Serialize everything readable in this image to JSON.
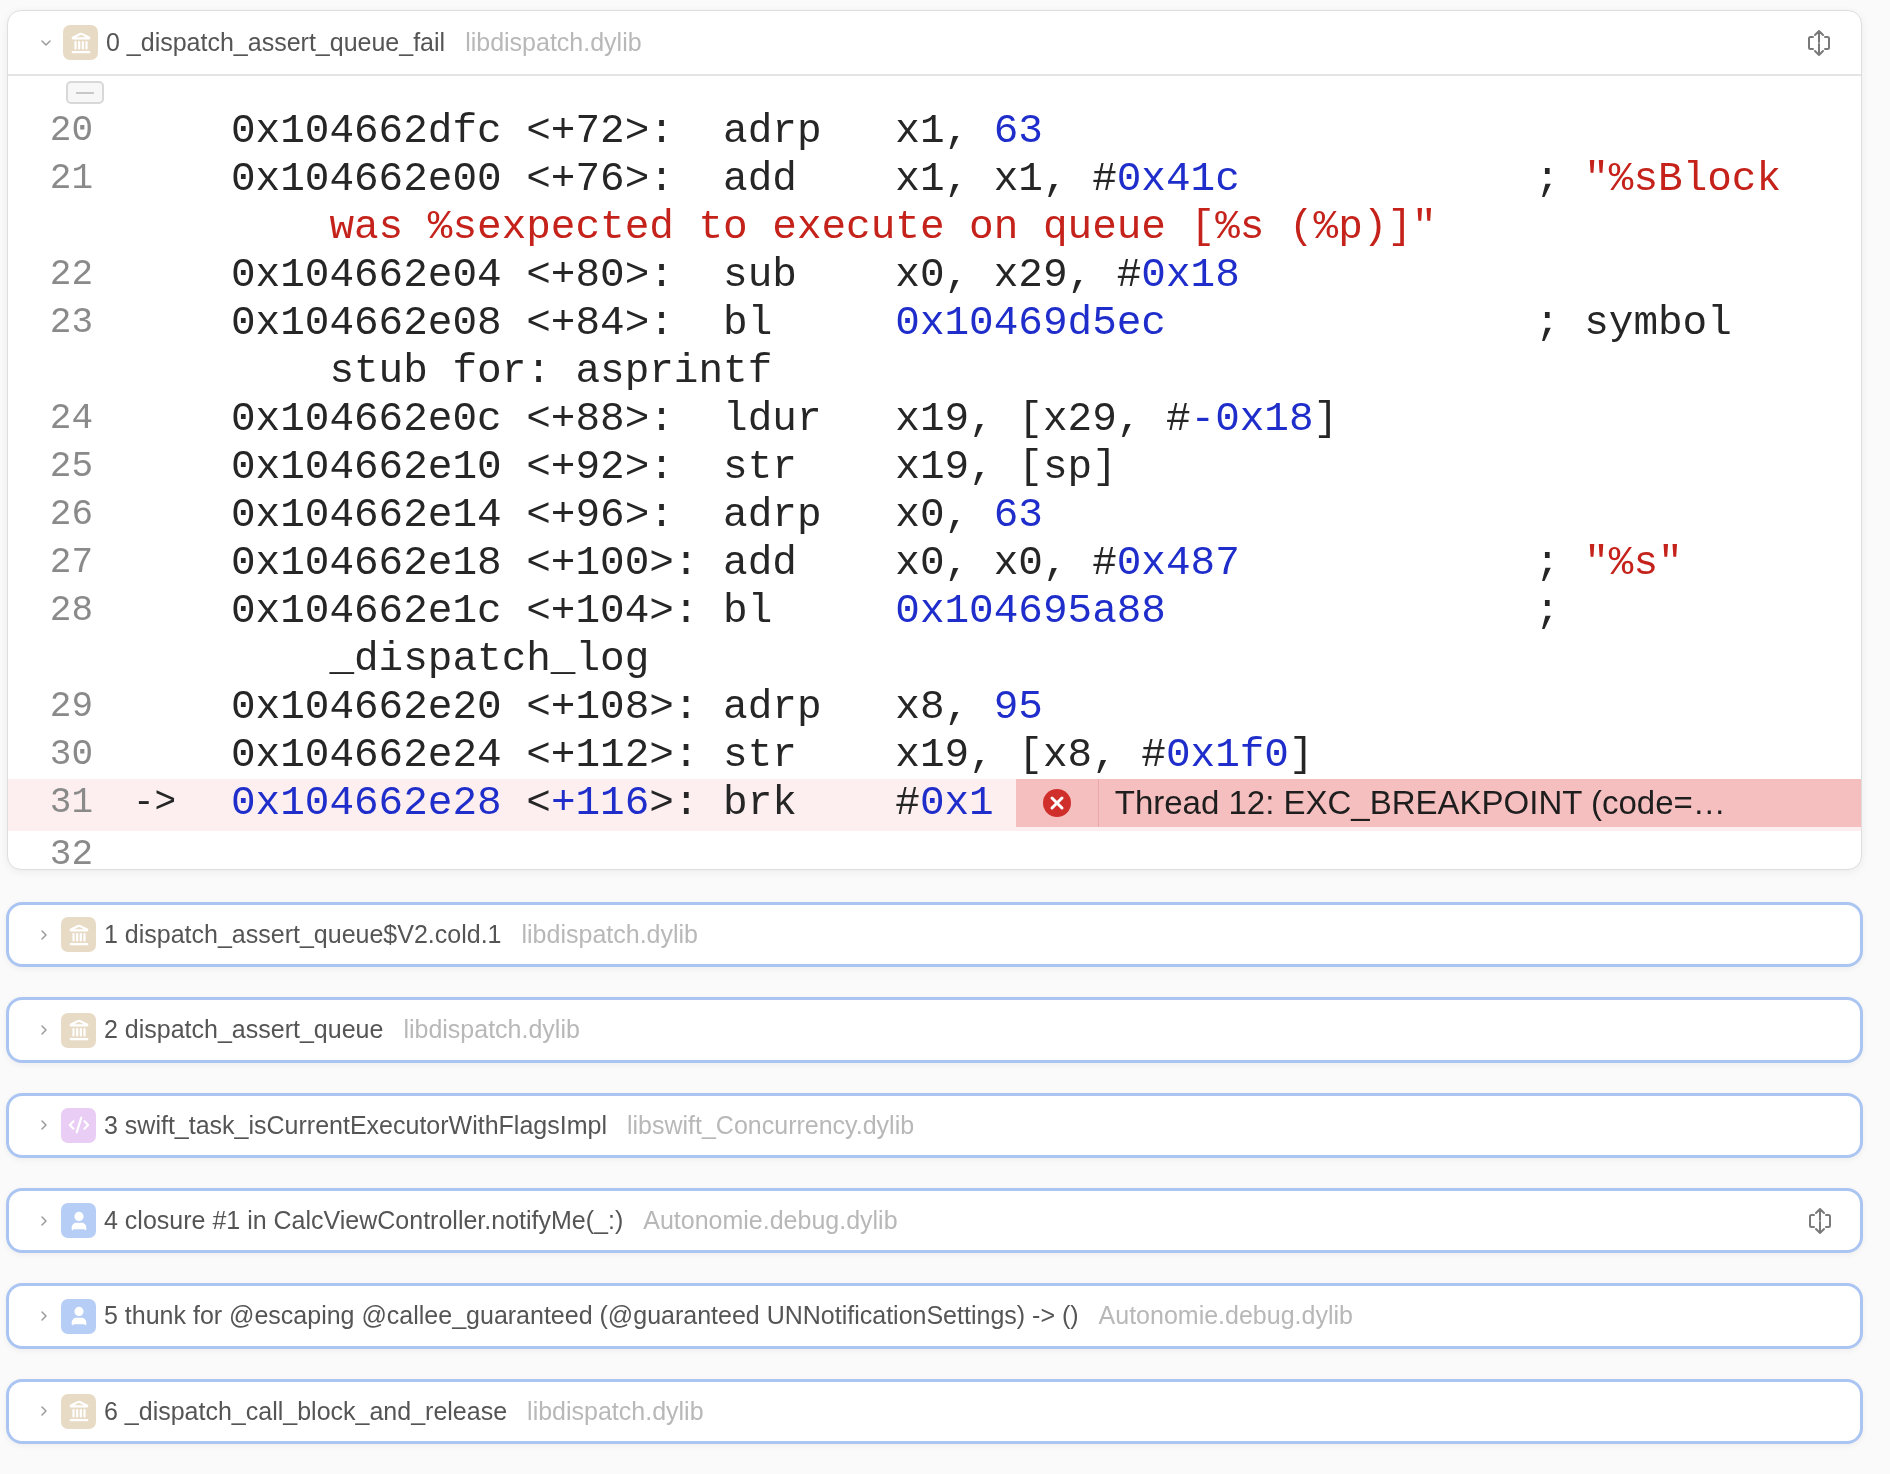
{
  "frames": [
    {
      "label": "0 _dispatch_assert_queue_fail",
      "library": "libdispatch.dylib",
      "kind": "library",
      "expanded": true,
      "focus_button": true,
      "disassembly": [
        {
          "number": "20",
          "address": [
            {
              "text": "0x104662dfc <+72>:",
              "kind": "plain"
            }
          ],
          "mnemonic": "adrp",
          "operands": [
            {
              "text": "x1, ",
              "kind": "plain"
            },
            {
              "text": "63",
              "kind": "num"
            }
          ]
        },
        {
          "number": "21",
          "address": [
            {
              "text": "0x104662e00 <+76>:",
              "kind": "plain"
            }
          ],
          "mnemonic": "add",
          "operands": [
            {
              "text": "x1, x1, #",
              "kind": "plain"
            },
            {
              "text": "0x41c",
              "kind": "num"
            }
          ],
          "comment": [
            {
              "text": "; ",
              "kind": "plain"
            },
            {
              "text": "\"%sBlock was %sexpected to execute on queue [%s (%p)]\"",
              "kind": "str"
            }
          ]
        },
        {
          "number": "22",
          "address": [
            {
              "text": "0x104662e04 <+80>:",
              "kind": "plain"
            }
          ],
          "mnemonic": "sub",
          "operands": [
            {
              "text": "x0, x29, #",
              "kind": "plain"
            },
            {
              "text": "0x18",
              "kind": "num"
            }
          ]
        },
        {
          "number": "23",
          "address": [
            {
              "text": "0x104662e08 <+84>:",
              "kind": "plain"
            }
          ],
          "mnemonic": "bl",
          "operands": [
            {
              "text": "0x10469d5ec",
              "kind": "num"
            }
          ],
          "comment": [
            {
              "text": "; symbol stub for: asprintf",
              "kind": "plain"
            }
          ]
        },
        {
          "number": "24",
          "address": [
            {
              "text": "0x104662e0c <+88>:",
              "kind": "plain"
            }
          ],
          "mnemonic": "ldur",
          "operands": [
            {
              "text": "x19, [x29, #",
              "kind": "plain"
            },
            {
              "text": "-0x18",
              "kind": "num"
            },
            {
              "text": "]",
              "kind": "plain"
            }
          ]
        },
        {
          "number": "25",
          "address": [
            {
              "text": "0x104662e10 <+92>:",
              "kind": "plain"
            }
          ],
          "mnemonic": "str",
          "operands": [
            {
              "text": "x19, [sp]",
              "kind": "plain"
            }
          ]
        },
        {
          "number": "26",
          "address": [
            {
              "text": "0x104662e14 <+96>:",
              "kind": "plain"
            }
          ],
          "mnemonic": "adrp",
          "operands": [
            {
              "text": "x0, ",
              "kind": "plain"
            },
            {
              "text": "63",
              "kind": "num"
            }
          ]
        },
        {
          "number": "27",
          "address": [
            {
              "text": "0x104662e18 <+100>:",
              "kind": "plain"
            }
          ],
          "mnemonic": "add",
          "operands": [
            {
              "text": "x0, x0, #",
              "kind": "plain"
            },
            {
              "text": "0x487",
              "kind": "num"
            }
          ],
          "comment": [
            {
              "text": "; ",
              "kind": "plain"
            },
            {
              "text": "\"%s\"",
              "kind": "str"
            }
          ]
        },
        {
          "number": "28",
          "address": [
            {
              "text": "0x104662e1c <+104>:",
              "kind": "plain"
            }
          ],
          "mnemonic": "bl",
          "operands": [
            {
              "text": "0x104695a88",
              "kind": "num"
            }
          ],
          "comment": [
            {
              "text": "; _dispatch_log",
              "kind": "plain"
            }
          ]
        },
        {
          "number": "29",
          "address": [
            {
              "text": "0x104662e20 <+108>:",
              "kind": "plain"
            }
          ],
          "mnemonic": "adrp",
          "operands": [
            {
              "text": "x8, ",
              "kind": "plain"
            },
            {
              "text": "95",
              "kind": "num"
            }
          ]
        },
        {
          "number": "30",
          "address": [
            {
              "text": "0x104662e24 <+112>:",
              "kind": "plain"
            }
          ],
          "mnemonic": "str",
          "operands": [
            {
              "text": "x19, [x8, #",
              "kind": "plain"
            },
            {
              "text": "0x1f0",
              "kind": "num"
            },
            {
              "text": "]",
              "kind": "plain"
            }
          ]
        },
        {
          "number": "31",
          "current": true,
          "marker": "->",
          "address": [
            {
              "text": "0x104662e28",
              "kind": "num"
            },
            {
              "text": " <",
              "kind": "plain"
            },
            {
              "text": "+116",
              "kind": "num"
            },
            {
              "text": ">:",
              "kind": "plain"
            }
          ],
          "mnemonic": "brk",
          "operands": [
            {
              "text": "#",
              "kind": "plain"
            },
            {
              "text": "0x1",
              "kind": "num"
            }
          ],
          "annotation": {
            "kind": "error",
            "text": "Thread 12: EXC_BREAKPOINT (code=…"
          }
        },
        {
          "number": "32"
        }
      ]
    },
    {
      "label": "1 dispatch_assert_queue$V2.cold.1",
      "library": "libdispatch.dylib",
      "kind": "library",
      "expanded": false,
      "focus_button": false
    },
    {
      "label": "2 dispatch_assert_queue",
      "library": "libdispatch.dylib",
      "kind": "library",
      "expanded": false,
      "focus_button": false
    },
    {
      "label": "3 swift_task_isCurrentExecutorWithFlagsImpl",
      "library": "libswift_Concurrency.dylib",
      "kind": "code",
      "expanded": false,
      "focus_button": false
    },
    {
      "label": "4 closure #1 in CalcViewController.notifyMe(_:)",
      "library": "Autonomie.debug.dylib",
      "kind": "user",
      "expanded": false,
      "focus_button": true
    },
    {
      "label": "5 thunk for @escaping @callee_guaranteed (@guaranteed UNNotificationSettings) -> ()",
      "library": "Autonomie.debug.dylib",
      "kind": "user",
      "expanded": false,
      "focus_button": false
    },
    {
      "label": "6 _dispatch_call_block_and_release",
      "library": "libdispatch.dylib",
      "kind": "library",
      "expanded": false,
      "focus_button": false
    }
  ]
}
